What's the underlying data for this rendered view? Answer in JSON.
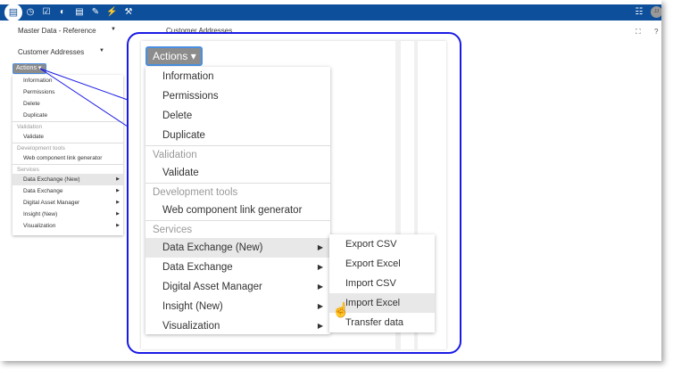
{
  "topbar": {
    "icons": [
      "database-icon",
      "clock-icon",
      "checkbox-icon",
      "dashboard-icon",
      "document-icon",
      "edit-icon",
      "plug-icon",
      "wrench-icon"
    ],
    "right_icons": [
      "list-icon"
    ],
    "avatar": "JJ",
    "color": "#0d4f9b"
  },
  "nav": {
    "dataspace": "Master Data - Reference",
    "table": "Customer Addresses",
    "main_title": "Customer Addresses"
  },
  "actions": {
    "label": "Actions",
    "groups": [
      {
        "header": "",
        "items": [
          {
            "label": "Information"
          },
          {
            "label": "Permissions"
          },
          {
            "label": "Delete"
          },
          {
            "label": "Duplicate"
          }
        ]
      },
      {
        "header": "Validation",
        "items": [
          {
            "label": "Validate"
          }
        ]
      },
      {
        "header": "Development tools",
        "items": [
          {
            "label": "Web component link generator"
          }
        ]
      },
      {
        "header": "Services",
        "items": [
          {
            "label": "Data Exchange (New)",
            "sub": true,
            "highlighted": true
          },
          {
            "label": "Data Exchange",
            "sub": true
          },
          {
            "label": "Digital Asset Manager",
            "sub": true
          },
          {
            "label": "Insight (New)",
            "sub": true
          },
          {
            "label": "Visualization",
            "sub": true
          }
        ]
      }
    ]
  },
  "submenu": {
    "items": [
      "Export CSV",
      "Export Excel",
      "Import CSV",
      "Import Excel",
      "Transfer data"
    ],
    "highlighted": "Import Excel"
  },
  "callout_color": "#1a1ae6"
}
